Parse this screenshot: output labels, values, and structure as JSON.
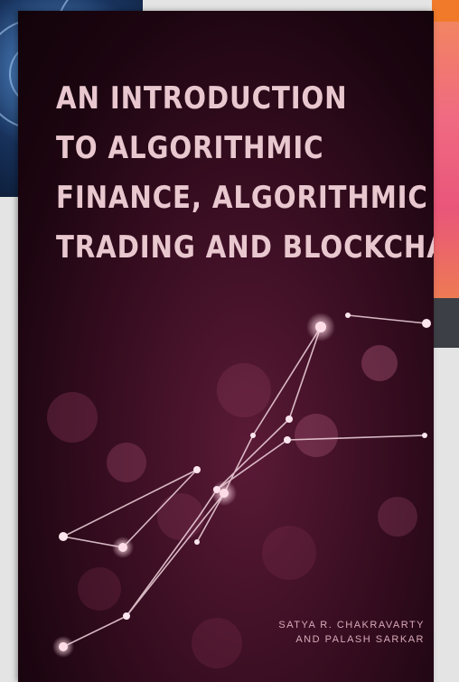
{
  "cover": {
    "title_lines": [
      "AN INTRODUCTION",
      "TO ALGORITHMIC",
      "FINANCE, ALGORITHMIC",
      "TRADING AND BLOCKCHAIN"
    ],
    "authors": [
      "SATYA R. CHAKRAVARTY",
      "AND PALASH SARKAR"
    ],
    "colors": {
      "background": "#3a0e22",
      "title": "#e9c7cf",
      "network": "#f3d6df"
    }
  }
}
